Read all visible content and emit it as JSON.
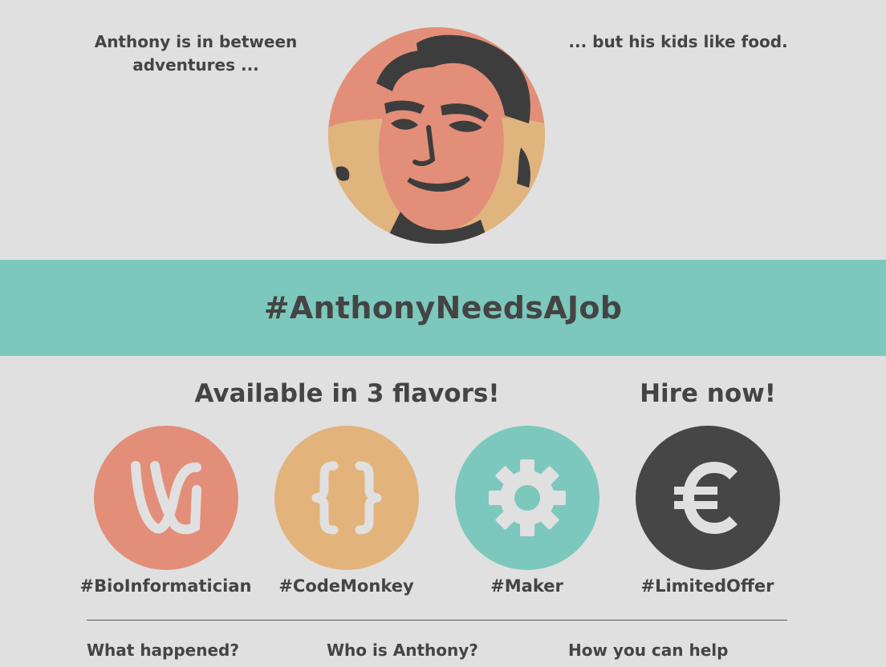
{
  "hero": {
    "left_tagline": "Anthony is in between adventures ...",
    "right_tagline": "... but his kids like food."
  },
  "banner": {
    "title": "#AnthonyNeedsAJob"
  },
  "offers": {
    "flavors_heading": "Available in 3 flavors!",
    "hire_heading": "Hire now!",
    "items": [
      {
        "label": "#BioInformatician",
        "icon": "dna-icon",
        "color": "#e38e78"
      },
      {
        "label": "#CodeMonkey",
        "icon": "curly-braces-icon",
        "color": "#e2b47b"
      },
      {
        "label": "#Maker",
        "icon": "gear-icon",
        "color": "#7cc8bd"
      },
      {
        "label": "#LimitedOffer",
        "icon": "euro-icon",
        "color": "#464646"
      }
    ]
  },
  "footer_nav": {
    "items": [
      {
        "label": "What happened?"
      },
      {
        "label": "Who is Anthony?"
      },
      {
        "label": "How you can help"
      }
    ]
  },
  "colors": {
    "background": "#e0e0e0",
    "accent_teal": "#7cc8bd",
    "accent_salmon": "#e38e78",
    "accent_sand": "#e2b47b",
    "dark": "#464646",
    "text": "#444444"
  }
}
